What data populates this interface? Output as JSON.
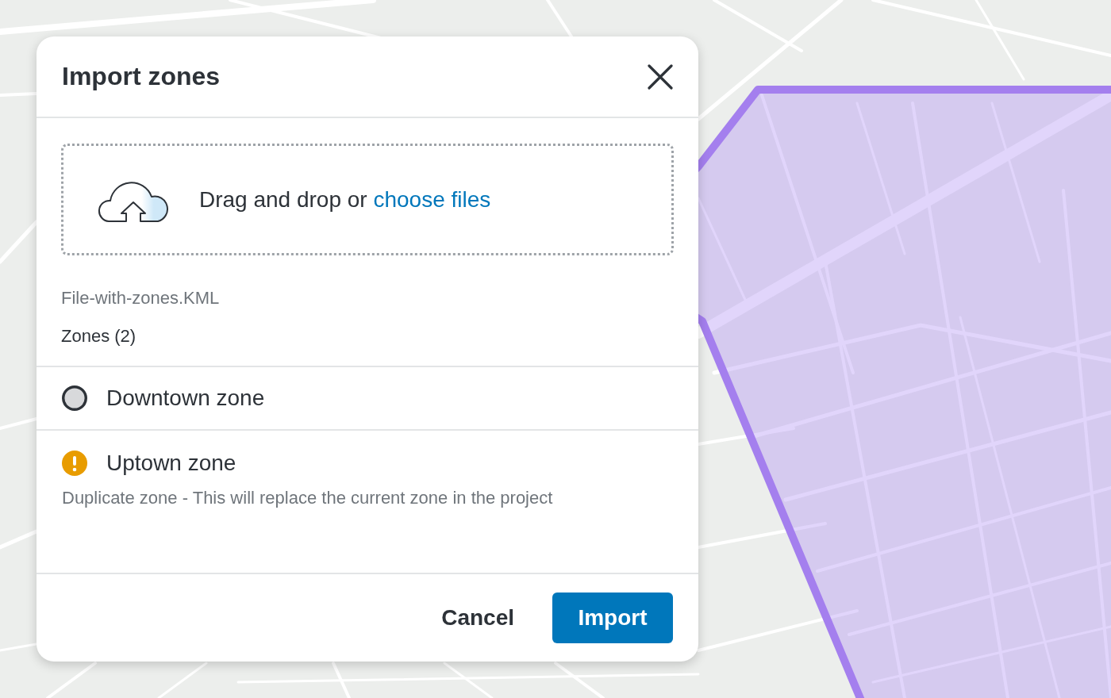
{
  "dialog": {
    "title": "Import zones",
    "dropzone": {
      "text": "Drag and drop or",
      "link": "choose files"
    },
    "file_name": "File-with-zones.KML",
    "zones_heading": "Zones (2)",
    "zones": [
      {
        "name": "Downtown zone",
        "kind": "new"
      },
      {
        "name": "Uptown zone",
        "kind": "duplicate",
        "message": "Duplicate zone - This will replace the current zone in the project"
      }
    ],
    "buttons": [
      {
        "label": "Cancel",
        "kind": "secondary"
      },
      {
        "label": "Import",
        "kind": "primary"
      }
    ]
  }
}
